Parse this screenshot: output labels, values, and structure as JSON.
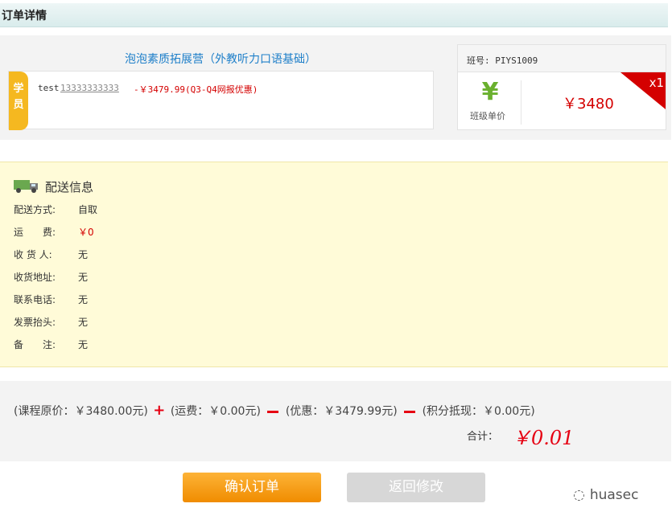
{
  "header": {
    "title": "订单详情"
  },
  "course": {
    "title": "泡泡素质拓展营（外教听力口语基础）",
    "student_tag": "学员",
    "student_name": "test",
    "student_phone": "13333333333",
    "student_price": "-￥3479.99(Q3-Q4网报优惠)"
  },
  "class_info": {
    "class_no": "班号: PIYS1009",
    "unit_label": "班级单价",
    "unit_price": "￥3480",
    "quantity_badge": "x1",
    "icon": "yen-icon"
  },
  "delivery": {
    "title": "配送信息",
    "rows": [
      {
        "key": "配送方式:",
        "value": "自取"
      },
      {
        "key": "运　　费:",
        "value": "￥0"
      },
      {
        "key": "收 货 人:",
        "value": "无"
      },
      {
        "key": "收货地址:",
        "value": "无"
      },
      {
        "key": "联系电话:",
        "value": "无"
      },
      {
        "key": "发票抬头:",
        "value": "无"
      },
      {
        "key": "备　　注:",
        "value": "无"
      }
    ]
  },
  "summary": {
    "original": "(课程原价：￥3480.00元)",
    "shipping": "(运费：￥0.00元)",
    "discount": "(优惠：￥3479.99元)",
    "points": "(积分抵现：￥0.00元)",
    "total_label": "合计：",
    "total_value": "￥0.01"
  },
  "buttons": {
    "confirm": "确认订单",
    "back": "返回修改"
  },
  "watermark": {
    "text": "huasec"
  },
  "colors": {
    "accent_red": "#e60012",
    "confirm_orange": "#f5a013",
    "delivery_bg": "#fffbd8"
  }
}
